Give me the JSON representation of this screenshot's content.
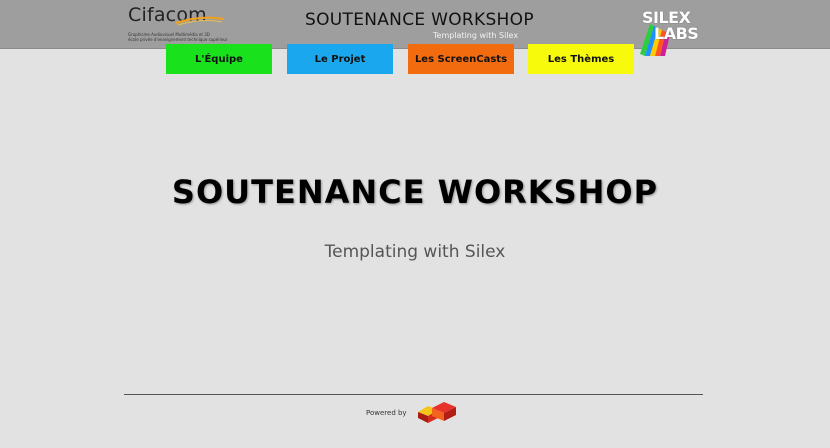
{
  "header": {
    "cifacom": {
      "brand": "Cifacom",
      "tagline_1": "Graphisme Audiovisuel Multimédia et 3D",
      "tagline_2": "école privée d'enseignement technique supérieur"
    },
    "title": "SOUTENANCE WORKSHOP",
    "subtitle": "Templating with Silex",
    "silex_logo": {
      "word_1": "SILEX",
      "word_2": "LABS"
    }
  },
  "nav": {
    "items": [
      {
        "label": "L'Équipe",
        "color": "#19e21d"
      },
      {
        "label": "Le Projet",
        "color": "#1aa7ee"
      },
      {
        "label": "Les ScreenCasts",
        "color": "#f26b0f"
      },
      {
        "label": "Les Thèmes",
        "color": "#f8fa0c"
      }
    ]
  },
  "main": {
    "title": "SOUTENANCE WORKSHOP",
    "subtitle": "Templating with Silex"
  },
  "footer": {
    "powered_by": "Powered by",
    "powered_logo_icon": "silex-cube-logo-icon"
  },
  "colors": {
    "background": "#e2e2e2",
    "header": "#9e9e9e"
  }
}
